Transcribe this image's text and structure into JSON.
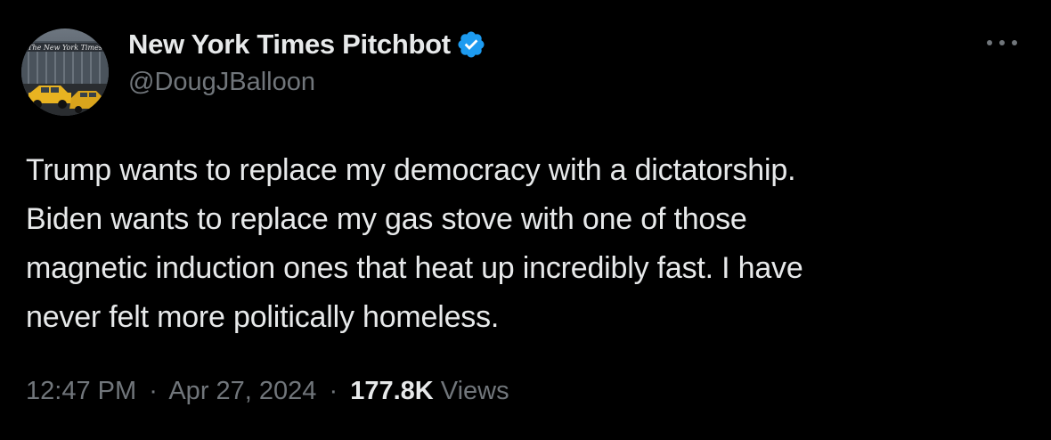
{
  "author": {
    "display_name": "New York Times Pitchbot",
    "handle": "@DougJBalloon",
    "verified": true,
    "avatar_text": "The New York Times"
  },
  "tweet": {
    "text": "Trump wants to replace my democracy with a dictatorship.\nBiden wants to replace my gas stove with one of those\nmagnetic induction ones that heat up incredibly fast. I have\nnever felt more politically homeless."
  },
  "meta": {
    "time": "12:47 PM",
    "separator": "·",
    "date": "Apr 27, 2024",
    "views_count": "177.8K",
    "views_label": "Views"
  },
  "icons": {
    "verified": "verified-badge-icon",
    "more": "more-horizontal-icon"
  },
  "colors": {
    "background": "#000000",
    "primary_text": "#e7e9ea",
    "secondary_text": "#71767b",
    "verified_blue": "#1d9bf0"
  }
}
